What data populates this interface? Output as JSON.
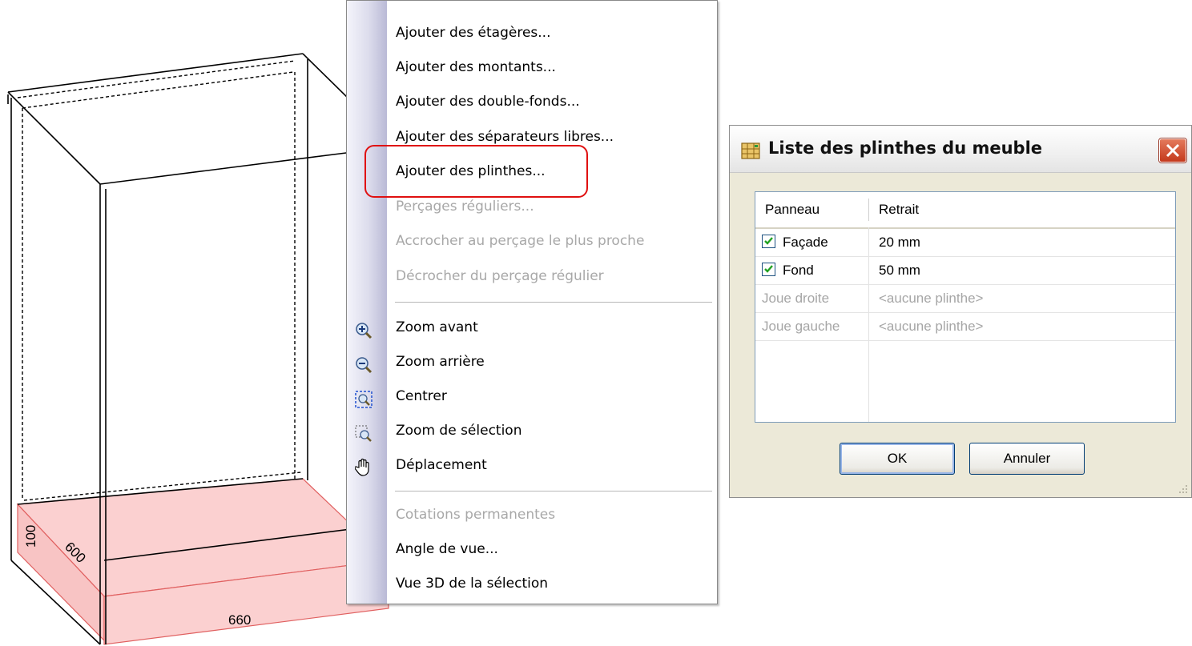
{
  "drawing": {
    "dimension_height": "100",
    "dimension_depth": "600",
    "dimension_width": "660"
  },
  "menu": {
    "items": [
      {
        "label": "Ajouter des étagères...",
        "enabled": true
      },
      {
        "label": "Ajouter des montants...",
        "enabled": true
      },
      {
        "label": "Ajouter des double-fonds...",
        "enabled": true
      },
      {
        "label": "Ajouter des séparateurs libres...",
        "enabled": true
      },
      {
        "label": "Ajouter des plinthes...",
        "enabled": true,
        "highlighted": true
      },
      {
        "label": "Perçages réguliers...",
        "enabled": false
      },
      {
        "label": "Accrocher au perçage le plus proche",
        "enabled": false
      },
      {
        "label": "Décrocher du perçage régulier",
        "enabled": false
      },
      {
        "label": "Zoom avant",
        "enabled": true,
        "icon": "zoom-in-icon"
      },
      {
        "label": "Zoom arrière",
        "enabled": true,
        "icon": "zoom-out-icon"
      },
      {
        "label": "Centrer",
        "enabled": true,
        "icon": "center-view-icon"
      },
      {
        "label": "Zoom de sélection",
        "enabled": true,
        "icon": "zoom-selection-icon"
      },
      {
        "label": "Déplacement",
        "enabled": true,
        "icon": "hand-pan-icon"
      },
      {
        "label": "Cotations permanentes",
        "enabled": false
      },
      {
        "label": "Angle de vue...",
        "enabled": true
      },
      {
        "label": "Vue 3D de la sélection",
        "enabled": true
      }
    ]
  },
  "dialog": {
    "title": "Liste des plinthes du meuble",
    "columns": [
      "Panneau",
      "Retrait"
    ],
    "rows": [
      {
        "panel": "Façade",
        "offset": "20 mm",
        "checked": true,
        "enabled": true
      },
      {
        "panel": "Fond",
        "offset": "50 mm",
        "checked": true,
        "enabled": true
      },
      {
        "panel": "Joue droite",
        "offset": "<aucune plinthe>",
        "checked": false,
        "enabled": false
      },
      {
        "panel": "Joue gauche",
        "offset": "<aucune plinthe>",
        "checked": false,
        "enabled": false
      }
    ],
    "ok_label": "OK",
    "cancel_label": "Annuler"
  },
  "colors": {
    "plinth_fill": "#fbd0d0",
    "plinth_stroke": "#e06060",
    "highlight_border": "#e01010",
    "dialog_bg": "#ece9d8"
  }
}
